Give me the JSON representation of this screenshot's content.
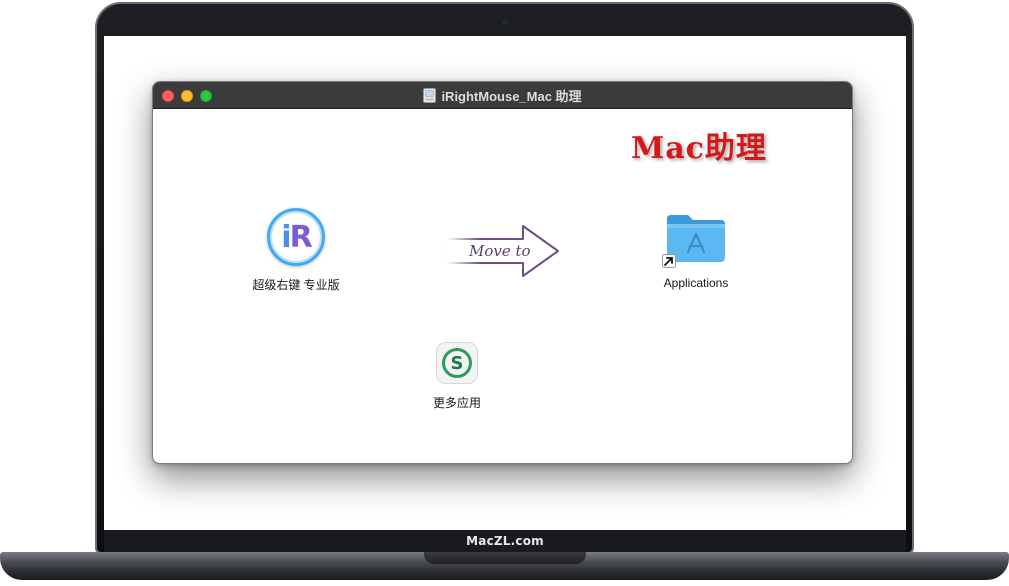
{
  "laptop": {
    "brand_label": "MacZL.com"
  },
  "window": {
    "title": "iRightMouse_Mac 助理",
    "disk_icon": "disk-image-icon",
    "controls": [
      "close",
      "minimize",
      "maximize"
    ]
  },
  "content": {
    "watermark": "Mac助理",
    "app": {
      "label": "超级右键 专业版",
      "icon": "irightmouse-app-icon"
    },
    "arrow": {
      "label": "Move to",
      "icon": "arrow-right-icon"
    },
    "applications_folder": {
      "label": "Applications",
      "icon": "applications-folder-icon",
      "alias_icon": "alias-arrow-icon"
    },
    "more_apps": {
      "label": "更多应用",
      "icon": "more-apps-icon"
    }
  },
  "colors": {
    "titlebar": "#3b3b3d",
    "close": "#fe5f57",
    "minimize": "#febc2e",
    "maximize": "#28c840",
    "watermark": "#d21a1a",
    "folder": "#4fb0ec",
    "arrow_fill": "#6d4e8a"
  }
}
